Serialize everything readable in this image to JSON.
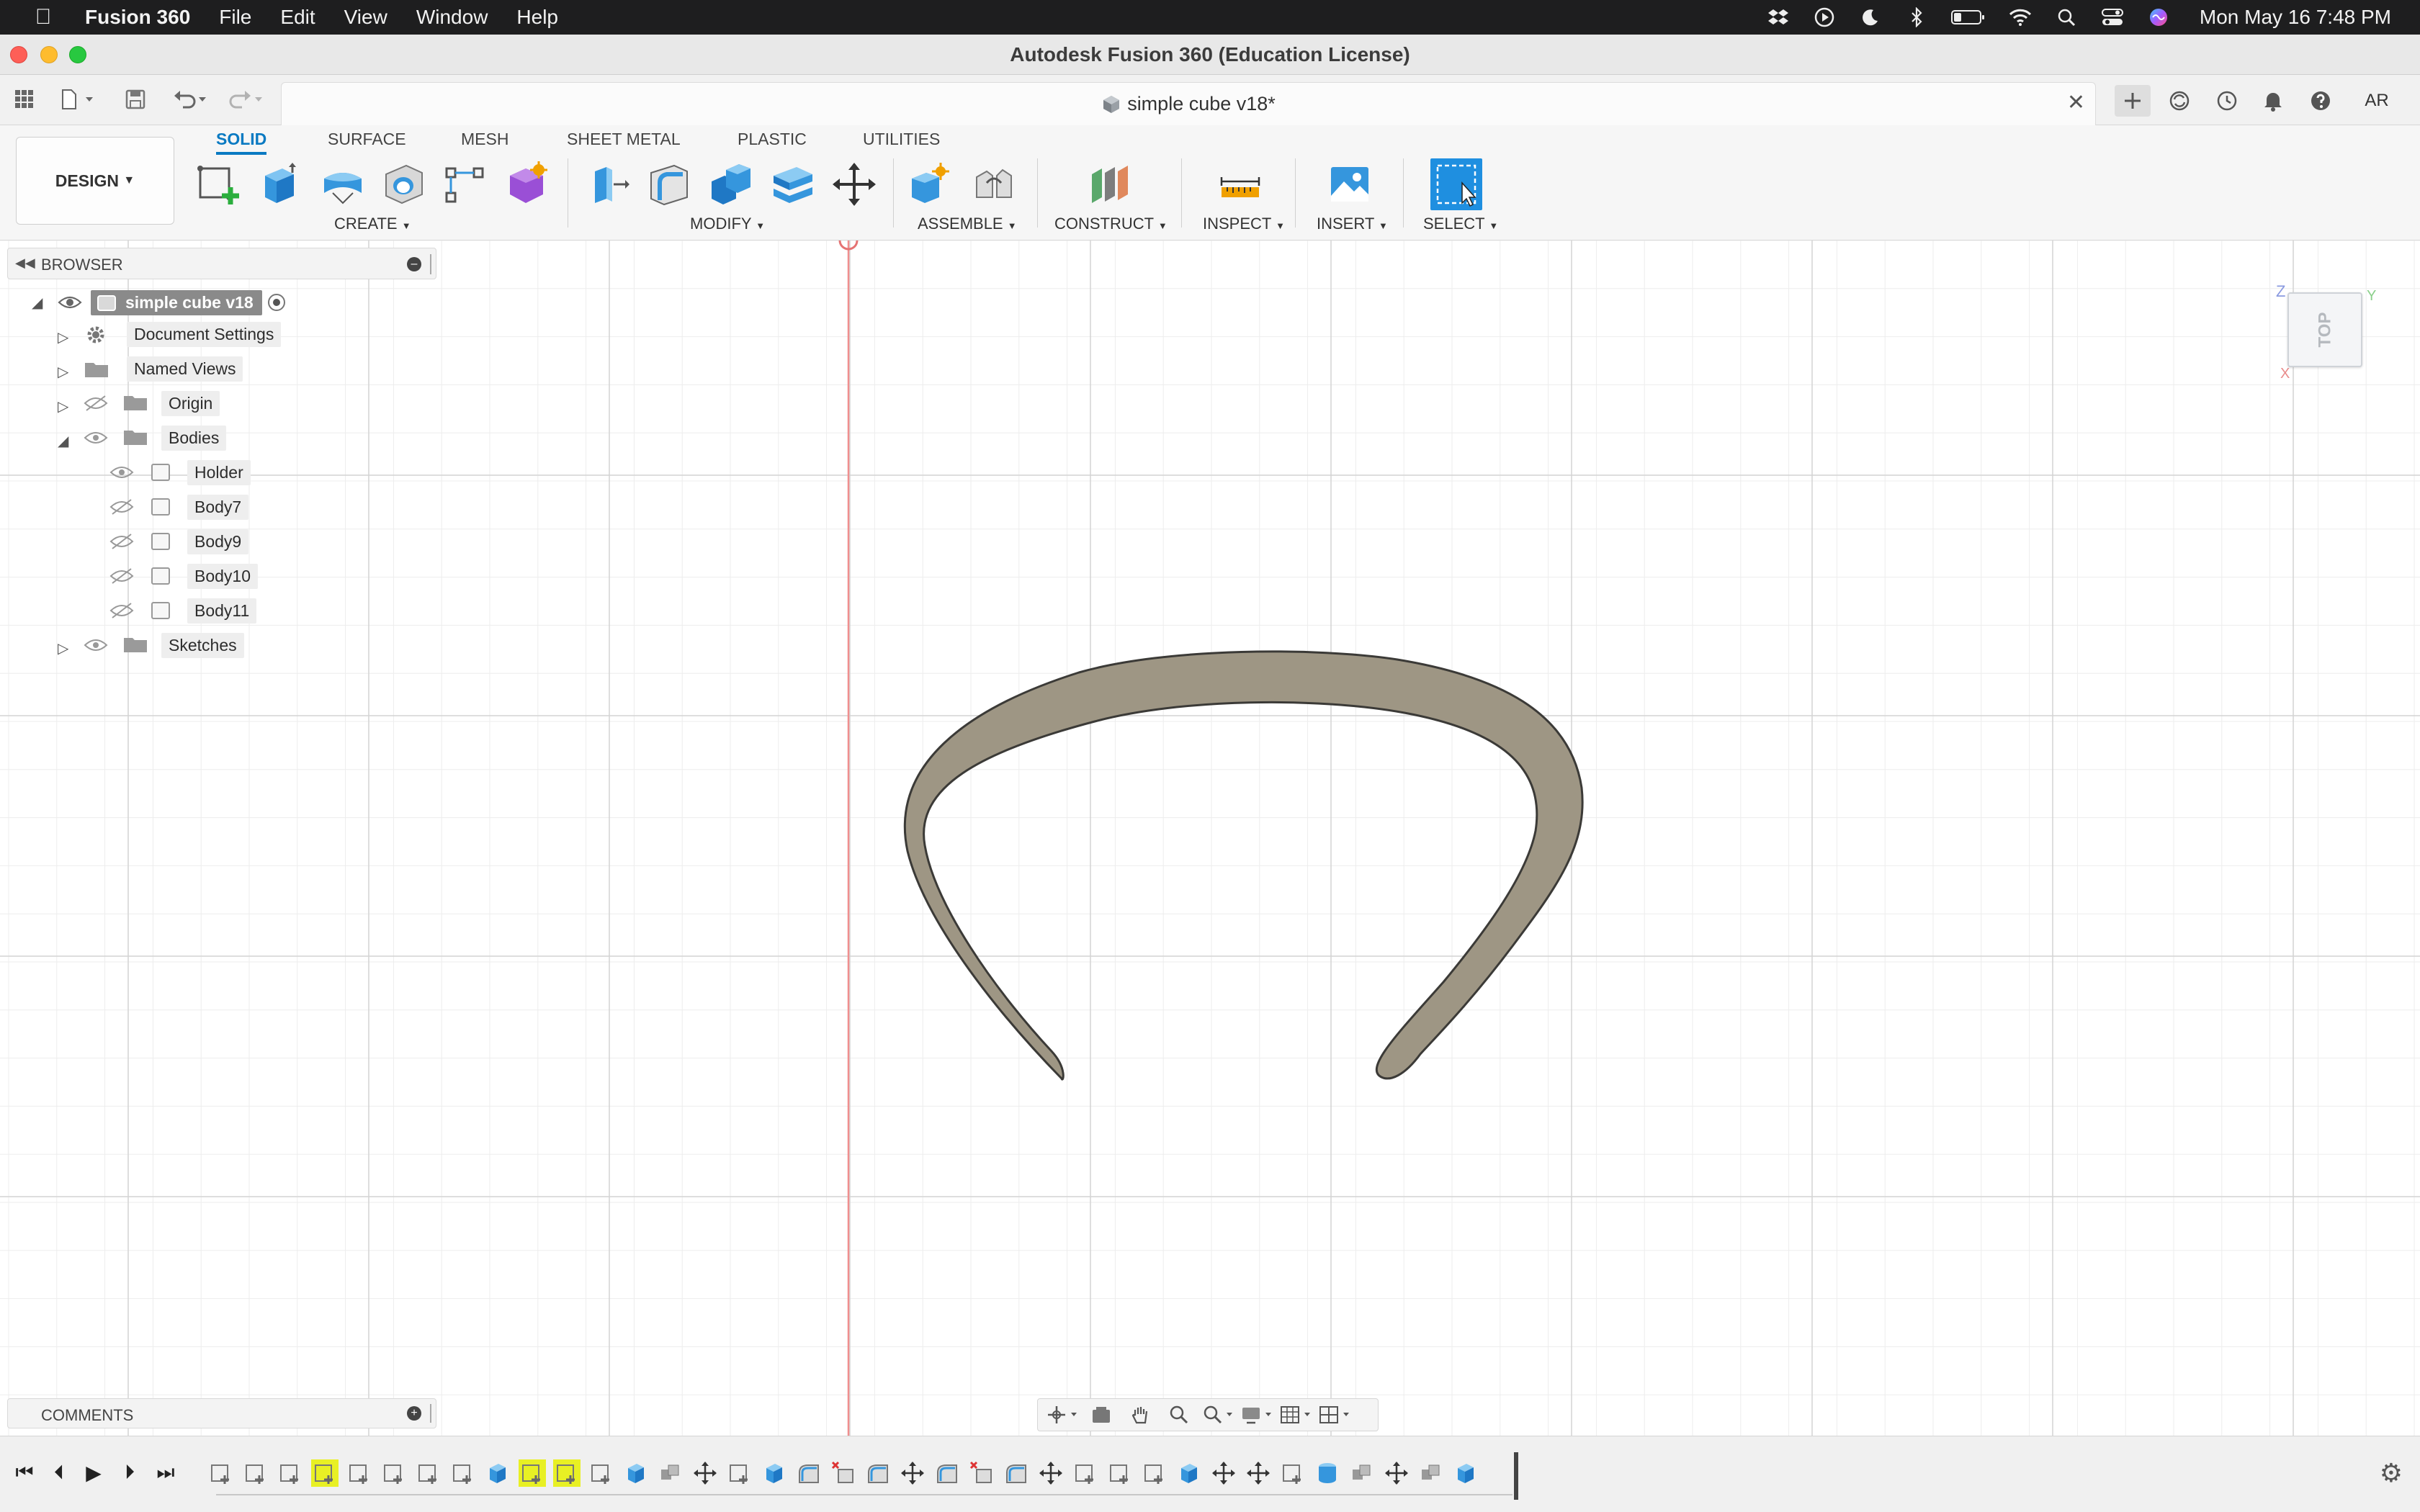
{
  "menubar": {
    "app_name": "Fusion 360",
    "items": [
      "File",
      "Edit",
      "View",
      "Window",
      "Help"
    ],
    "datetime": "Mon May 16  7:48 PM",
    "status_icons": [
      "dropbox-icon",
      "play-icon",
      "moon-icon",
      "bluetooth-icon",
      "battery-icon",
      "wifi-icon",
      "spotlight-icon",
      "control-center-icon",
      "siri-icon"
    ]
  },
  "window": {
    "title": "Autodesk Fusion 360 (Education License)"
  },
  "tabbar": {
    "doc_title": "simple cube v18*",
    "user_initials": "AR"
  },
  "toolbar": {
    "workspace": "DESIGN",
    "tabs": [
      "SOLID",
      "SURFACE",
      "MESH",
      "SHEET METAL",
      "PLASTIC",
      "UTILITIES"
    ],
    "active_tab": "SOLID",
    "groups": {
      "create": "CREATE",
      "modify": "MODIFY",
      "assemble": "ASSEMBLE",
      "construct": "CONSTRUCT",
      "inspect": "INSPECT",
      "insert": "INSERT",
      "select": "SELECT"
    },
    "accent": "#0a7ac2"
  },
  "browser": {
    "title": "BROWSER",
    "root": "simple cube v18",
    "items": {
      "document_settings": "Document Settings",
      "named_views": "Named Views",
      "origin": "Origin",
      "bodies": "Bodies",
      "sketches": "Sketches"
    },
    "bodies": [
      "Holder",
      "Body7",
      "Body9",
      "Body10",
      "Body11"
    ]
  },
  "comments": {
    "title": "COMMENTS"
  },
  "viewcube": {
    "face": "TOP",
    "axes": [
      "Z",
      "Y",
      "X"
    ]
  },
  "model": {
    "fill_color": "#9e9684",
    "outline_color": "#3b3a37"
  }
}
